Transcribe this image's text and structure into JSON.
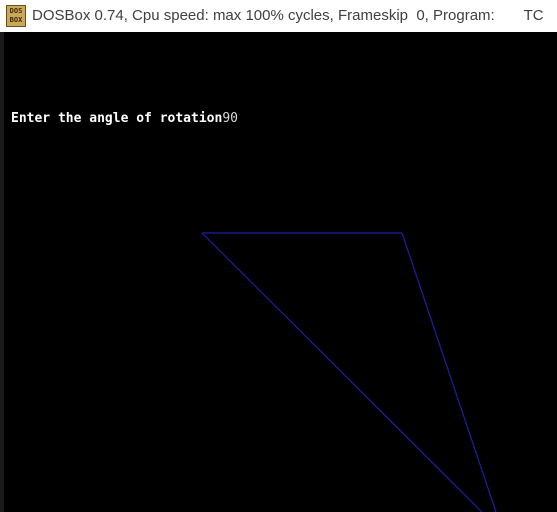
{
  "window": {
    "title": "DOSBox 0.74, Cpu speed: max 100% cycles, Frameskip  0, Program:       TC",
    "icon": "dosbox-app-icon",
    "icon_text_top": "DOS",
    "icon_text_bottom": "BOX"
  },
  "console": {
    "prompt_text": "Enter the angle of rotation",
    "input_value": "90",
    "text_color": "#ffffff",
    "background_color": "#000000"
  },
  "drawing": {
    "shape": "triangle",
    "stroke_color": "#1f1fa8"
  }
}
